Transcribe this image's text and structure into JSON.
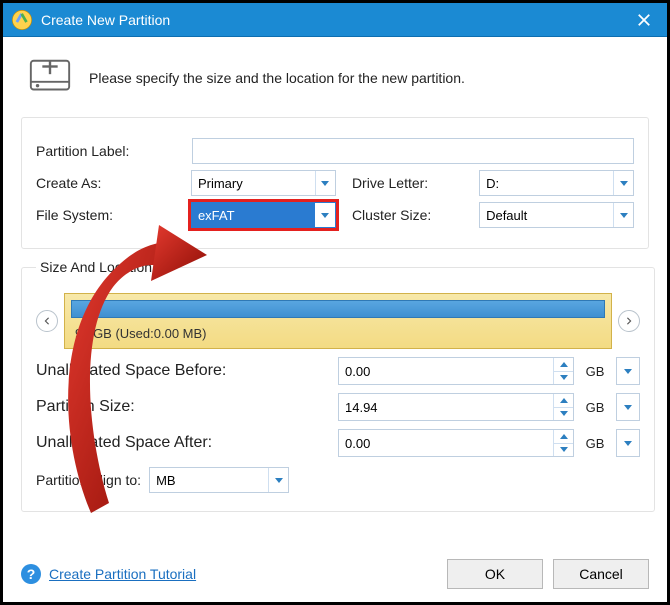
{
  "titlebar": {
    "title": "Create New Partition"
  },
  "intro": {
    "text": "Please specify the size and the location for the new partition."
  },
  "labels": {
    "partition_label": "Partition Label:",
    "create_as": "Create As:",
    "drive_letter": "Drive Letter:",
    "file_system": "File System:",
    "cluster_size": "Cluster Size:"
  },
  "values": {
    "partition_label": "",
    "create_as": "Primary",
    "drive_letter": "D:",
    "file_system": "exFAT",
    "cluster_size": "Default"
  },
  "size_location": {
    "legend": "Size And Location",
    "disk_caption": "94 GB (Used:0.00 MB)",
    "rows": {
      "space_before_label": "Unallocated Space Before:",
      "space_before_value": "0.00",
      "partition_size_label": "Partition Size:",
      "partition_size_value": "14.94",
      "space_after_label": "Unallocated Space After:",
      "space_after_value": "0.00",
      "unit": "GB"
    },
    "align": {
      "label": "Partition Align to:",
      "value": "MB"
    }
  },
  "footer": {
    "tutorial": "Create Partition Tutorial",
    "ok": "OK",
    "cancel": "Cancel"
  }
}
